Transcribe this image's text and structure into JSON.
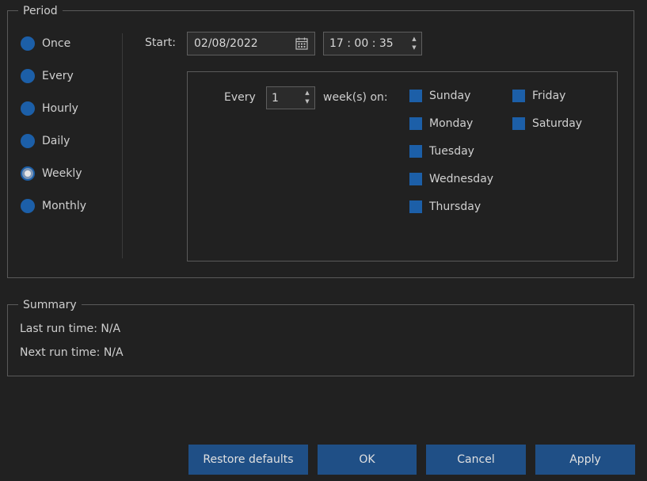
{
  "period": {
    "legend": "Period",
    "options": [
      {
        "label": "Once",
        "checked": false
      },
      {
        "label": "Every",
        "checked": false
      },
      {
        "label": "Hourly",
        "checked": false
      },
      {
        "label": "Daily",
        "checked": false
      },
      {
        "label": "Weekly",
        "checked": true
      },
      {
        "label": "Monthly",
        "checked": false
      }
    ],
    "start_label": "Start:",
    "start_date": "02/08/2022",
    "start_time": "17 : 00 : 35"
  },
  "weekly": {
    "every_label": "Every",
    "every_value": "1",
    "weeks_on_label": "week(s) on:",
    "days": [
      {
        "label": "Sunday",
        "checked": true
      },
      {
        "label": "Monday",
        "checked": true
      },
      {
        "label": "Tuesday",
        "checked": true
      },
      {
        "label": "Wednesday",
        "checked": true
      },
      {
        "label": "Thursday",
        "checked": true
      },
      {
        "label": "Friday",
        "checked": true
      },
      {
        "label": "Saturday",
        "checked": true
      }
    ]
  },
  "summary": {
    "legend": "Summary",
    "last_run": "Last run time: N/A",
    "next_run": "Next run time: N/A"
  },
  "buttons": {
    "restore": "Restore defaults",
    "ok": "OK",
    "cancel": "Cancel",
    "apply": "Apply"
  },
  "colors": {
    "background": "#212121",
    "accent": "#1c5fa8",
    "button": "#1f4f86",
    "border": "#5a5a5a"
  },
  "icons": {
    "calendar": "calendar-icon",
    "spin_up": "spin-up-icon",
    "spin_down": "spin-down-icon"
  }
}
